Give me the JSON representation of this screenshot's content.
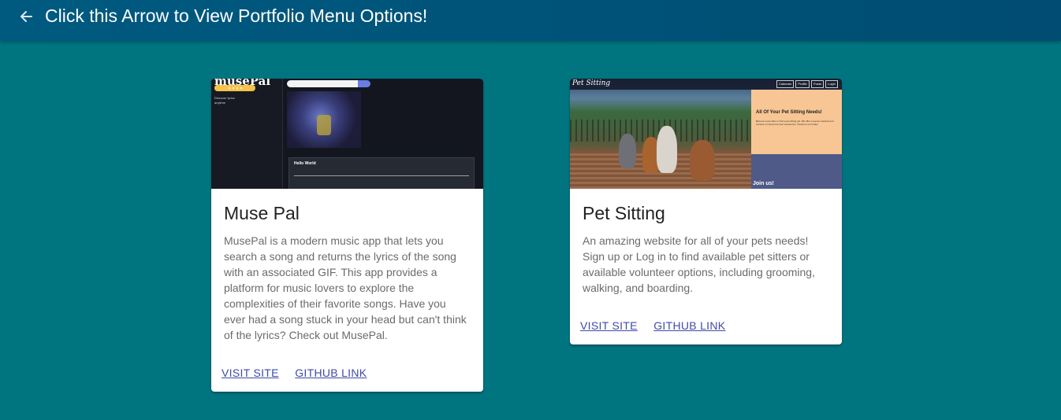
{
  "appbar": {
    "back_icon": "arrow-left-icon",
    "title": "Click this Arrow to View Portfolio Menu Options!"
  },
  "colors": {
    "background": "#007580",
    "appbar": "#004c72",
    "link": "#3f4aa8"
  },
  "cards": [
    {
      "title": "Muse Pal",
      "description": "MusePal is a modern music app that lets you search a song and returns the lyrics of the song with an associated GIF. This app provides a platform for music lovers to explore the complexities of their favorite songs. Have you ever had a song stuck in your head but can't think of the lyrics? Check out MusePal.",
      "visit_label": "VISIT SITE",
      "github_label": "GITHUB LINK",
      "preview": {
        "logo": "musePal",
        "side_text_1": "Discover lyrics",
        "side_text_2": "anytime",
        "panel_title": "Hello World",
        "panel_sub": "Local Hosting"
      }
    },
    {
      "title": "Pet Sitting",
      "description": "An amazing website for all of your pets needs! Sign up or Log in to find available pet sitters or available volunteer options, including grooming, walking, and boarding.",
      "visit_label": "VISIT SITE",
      "github_label": "GITHUB LINK",
      "preview": {
        "logo": "Pet Sitting",
        "nav": [
          "Calendar",
          "Profile",
          "Posts",
          "Login"
        ],
        "panel_heading": "All Of Your Pet Sitting Needs!",
        "panel_text": "Become a pet sitter or find a pet sitting job. We offer a secure network and reviews to ensure the best experience. Check us out today!",
        "join_text": "Join us!"
      }
    }
  ]
}
